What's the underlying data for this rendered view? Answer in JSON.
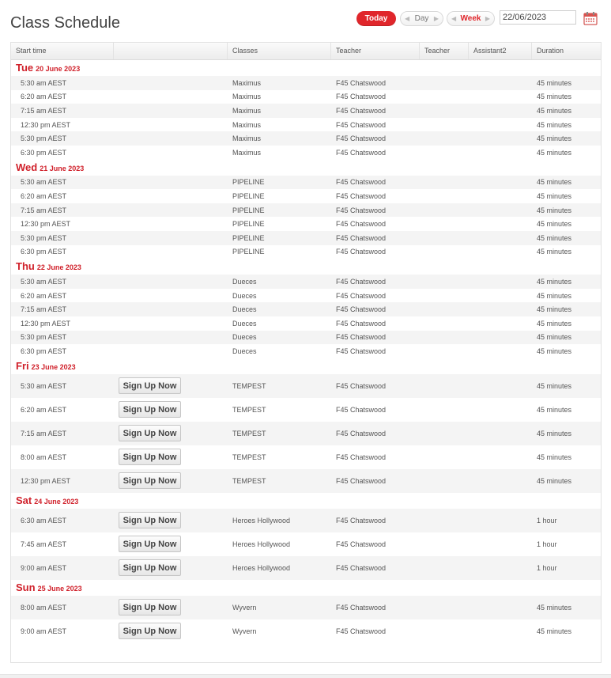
{
  "header": {
    "title": "Class Schedule",
    "today_label": "Today",
    "day_label": "Day",
    "week_label": "Week",
    "date_value": "22/06/2023"
  },
  "columns": [
    "Start time",
    "",
    "Classes",
    "Teacher",
    "Teacher",
    "Assistant2",
    "Duration"
  ],
  "signup_label": "Sign Up Now",
  "days": [
    {
      "name": "Tue",
      "date": "20 June 2023",
      "rows": [
        {
          "time": "5:30 am  AEST",
          "class": "Maximus",
          "teacher": "F45 Chatswood",
          "duration": "45 minutes"
        },
        {
          "time": "6:20 am  AEST",
          "class": "Maximus",
          "teacher": "F45 Chatswood",
          "duration": "45 minutes"
        },
        {
          "time": "7:15 am  AEST",
          "class": "Maximus",
          "teacher": "F45 Chatswood",
          "duration": "45 minutes"
        },
        {
          "time": "12:30 pm  AEST",
          "class": "Maximus",
          "teacher": "F45 Chatswood",
          "duration": "45 minutes"
        },
        {
          "time": "5:30 pm  AEST",
          "class": "Maximus",
          "teacher": "F45 Chatswood",
          "duration": "45 minutes"
        },
        {
          "time": "6:30 pm  AEST",
          "class": "Maximus",
          "teacher": "F45 Chatswood",
          "duration": "45 minutes"
        }
      ]
    },
    {
      "name": "Wed",
      "date": "21 June 2023",
      "rows": [
        {
          "time": "5:30 am  AEST",
          "class": "PIPELINE",
          "teacher": "F45 Chatswood",
          "duration": "45 minutes"
        },
        {
          "time": "6:20 am  AEST",
          "class": "PIPELINE",
          "teacher": "F45 Chatswood",
          "duration": "45 minutes"
        },
        {
          "time": "7:15 am  AEST",
          "class": "PIPELINE",
          "teacher": "F45 Chatswood",
          "duration": "45 minutes"
        },
        {
          "time": "12:30 pm  AEST",
          "class": "PIPELINE",
          "teacher": "F45 Chatswood",
          "duration": "45 minutes"
        },
        {
          "time": "5:30 pm  AEST",
          "class": "PIPELINE",
          "teacher": "F45 Chatswood",
          "duration": "45 minutes"
        },
        {
          "time": "6:30 pm  AEST",
          "class": "PIPELINE",
          "teacher": "F45 Chatswood",
          "duration": "45 minutes"
        }
      ]
    },
    {
      "name": "Thu",
      "date": "22 June 2023",
      "rows": [
        {
          "time": "5:30 am  AEST",
          "class": "Dueces",
          "teacher": "F45 Chatswood",
          "duration": "45 minutes"
        },
        {
          "time": "6:20 am  AEST",
          "class": "Dueces",
          "teacher": "F45 Chatswood",
          "duration": "45 minutes"
        },
        {
          "time": "7:15 am  AEST",
          "class": "Dueces",
          "teacher": "F45 Chatswood",
          "duration": "45 minutes"
        },
        {
          "time": "12:30 pm  AEST",
          "class": "Dueces",
          "teacher": "F45 Chatswood",
          "duration": "45 minutes"
        },
        {
          "time": "5:30 pm  AEST",
          "class": "Dueces",
          "teacher": "F45 Chatswood",
          "duration": "45 minutes"
        },
        {
          "time": "6:30 pm  AEST",
          "class": "Dueces",
          "teacher": "F45 Chatswood",
          "duration": "45 minutes"
        }
      ]
    },
    {
      "name": "Fri",
      "date": "23 June 2023",
      "signup": true,
      "rows": [
        {
          "time": "5:30 am  AEST",
          "class": "TEMPEST",
          "teacher": "F45 Chatswood",
          "duration": "45 minutes"
        },
        {
          "time": "6:20 am  AEST",
          "class": "TEMPEST",
          "teacher": "F45 Chatswood",
          "duration": "45 minutes"
        },
        {
          "time": "7:15 am  AEST",
          "class": "TEMPEST",
          "teacher": "F45 Chatswood",
          "duration": "45 minutes"
        },
        {
          "time": "8:00 am  AEST",
          "class": "TEMPEST",
          "teacher": "F45 Chatswood",
          "duration": "45 minutes"
        },
        {
          "time": "12:30 pm  AEST",
          "class": "TEMPEST",
          "teacher": "F45 Chatswood",
          "duration": "45 minutes"
        }
      ]
    },
    {
      "name": "Sat",
      "date": "24 June 2023",
      "signup": true,
      "rows": [
        {
          "time": "6:30 am  AEST",
          "class": "Heroes Hollywood",
          "teacher": "F45 Chatswood",
          "duration": "1 hour"
        },
        {
          "time": "7:45 am  AEST",
          "class": "Heroes Hollywood",
          "teacher": "F45 Chatswood",
          "duration": "1 hour"
        },
        {
          "time": "9:00 am  AEST",
          "class": "Heroes Hollywood",
          "teacher": "F45 Chatswood",
          "duration": "1 hour"
        }
      ]
    },
    {
      "name": "Sun",
      "date": "25 June 2023",
      "signup": true,
      "rows": [
        {
          "time": "8:00 am  AEST",
          "class": "Wyvern",
          "teacher": "F45 Chatswood",
          "duration": "45 minutes"
        },
        {
          "time": "9:00 am  AEST",
          "class": "Wyvern",
          "teacher": "F45 Chatswood",
          "duration": "45 minutes"
        }
      ]
    }
  ],
  "colors": {
    "accent": "#e0262b",
    "day_heading": "#d0202a",
    "row_alt": "#f4f4f4"
  }
}
